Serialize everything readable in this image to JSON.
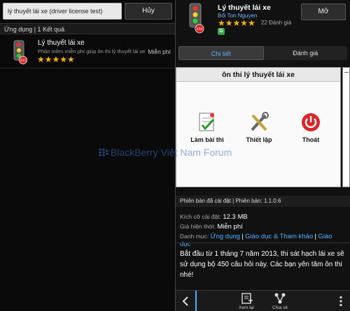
{
  "search": {
    "value": "lý thuyết lái xe (driver license test)",
    "cancel_label": "Hủy"
  },
  "results": {
    "header": "Ứng dụng | 1 Kết quả",
    "items": [
      {
        "title": "Lý thuyết lái xe",
        "description": "Phần mềm miễn phí giúp ôn thi lý thuyết lái xe",
        "price": "Miễn phí",
        "stars": "★★★★★",
        "icon": "traffic-light-icon"
      }
    ]
  },
  "watermark": {
    "text": "BlackBerry Việt Nam Forum"
  },
  "app": {
    "title": "Lý thuyết lái xe",
    "publisher": "Bối Ton Nguyen",
    "stars": "★★★★★",
    "rating_count": "22 Đánh giá",
    "open_label": "Mở",
    "badge_label": "G",
    "icon_number": "450"
  },
  "tabs": [
    {
      "label": "Chi tiết",
      "active": true
    },
    {
      "label": "Đánh giá",
      "active": false
    }
  ],
  "screenshot": {
    "title": "ôn thi lý thuyết lái xe",
    "buttons": [
      {
        "label": "Làm bài thi",
        "icon": "checklist-icon"
      },
      {
        "label": "Thiết lập",
        "icon": "tools-icon"
      },
      {
        "label": "Thoát",
        "icon": "power-icon"
      }
    ]
  },
  "version": {
    "text": "Phiên bản đã cài đặt | Phiên bản: 1.1.0.6"
  },
  "info": {
    "size_label": "Kích cỡ cài đặt:",
    "size_value": "12.3 MB",
    "price_label": "Giá hiện thời:",
    "price_value": "Miễn phí",
    "category_label": "Danh mục:",
    "category_1": "Ứng dụng",
    "category_2": "Giáo dục & Tham khảo",
    "category_3": "Giáo",
    "category_3b": "dục",
    "sep": "|"
  },
  "description": {
    "text": "Bắt đầu từ 1 tháng 7 năm 2013, thi sát hạch lái xe sẽ sử dụng bộ 450 câu hỏi này. Các bạn yên tâm ôn thi nhé!"
  },
  "bottom": {
    "reload_label": "Xem lại",
    "share_label": "Chia sẻ"
  },
  "colors": {
    "accent": "#4fb3ff",
    "star": "#f5b400"
  }
}
